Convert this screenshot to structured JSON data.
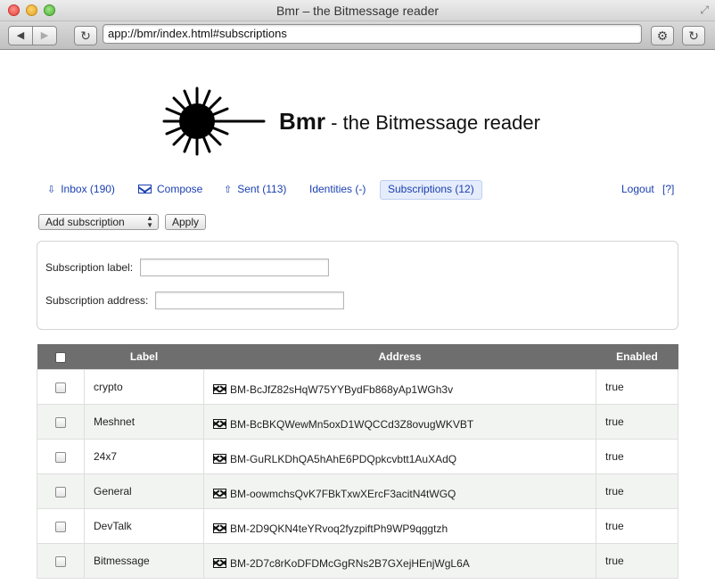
{
  "window": {
    "title": "Bmr – the Bitmessage reader",
    "url": "app://bmr/index.html#subscriptions"
  },
  "brand": {
    "name": "Bmr",
    "tagline": " - the Bitmessage reader"
  },
  "nav": {
    "inbox": "Inbox (190)",
    "compose": "Compose",
    "sent": "Sent (113)",
    "identities": "Identities (-)",
    "subscriptions": "Subscriptions (12)",
    "logout": "Logout",
    "help": "[?]"
  },
  "actions": {
    "select_value": "Add subscription",
    "apply_label": "Apply"
  },
  "form": {
    "label_text": "Subscription label:",
    "label_value": "",
    "address_text": "Subscription address:",
    "address_value": ""
  },
  "table": {
    "headers": {
      "label": "Label",
      "address": "Address",
      "enabled": "Enabled"
    },
    "rows": [
      {
        "label": "crypto",
        "address": "BM-BcJfZ82sHqW75YYBydFb868yAp1WGh3v",
        "enabled": "true"
      },
      {
        "label": "Meshnet",
        "address": "BM-BcBKQWewMn5oxD1WQCCd3Z8ovugWKVBT",
        "enabled": "true"
      },
      {
        "label": "24x7",
        "address": "BM-GuRLKDhQA5hAhE6PDQpkcvbtt1AuXAdQ",
        "enabled": "true"
      },
      {
        "label": "General",
        "address": "BM-oowmchsQvK7FBkTxwXErcF3acitN4tWGQ",
        "enabled": "true"
      },
      {
        "label": "DevTalk",
        "address": "BM-2D9QKN4teYRvoq2fyzpiftPh9WP9qggtzh",
        "enabled": "true"
      },
      {
        "label": "Bitmessage",
        "address": "BM-2D7c8rKoDFDMcGgRNs2B7GXejHEnjWgL6A",
        "enabled": "true"
      }
    ]
  }
}
